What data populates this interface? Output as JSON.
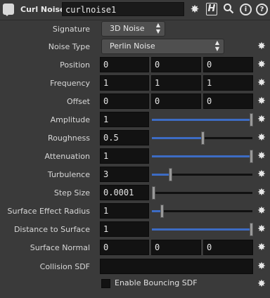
{
  "header": {
    "node_type": "Curl Noise",
    "node_name": "curlnoise1",
    "gear_icon": "gear-icon",
    "h_icon": "H",
    "search_icon": "search-icon",
    "info_icon": "i",
    "help_icon": "?"
  },
  "params": {
    "signature": {
      "label": "Signature",
      "value": "3D Noise"
    },
    "noise_type": {
      "label": "Noise Type",
      "value": "Perlin Noise"
    },
    "position": {
      "label": "Position",
      "v0": "0",
      "v1": "0",
      "v2": "0"
    },
    "frequency": {
      "label": "Frequency",
      "v0": "1",
      "v1": "1",
      "v2": "1"
    },
    "offset": {
      "label": "Offset",
      "v0": "0",
      "v1": "0",
      "v2": "0"
    },
    "amplitude": {
      "label": "Amplitude",
      "value": "1",
      "slider_fraction": 1.0
    },
    "roughness": {
      "label": "Roughness",
      "value": "0.5",
      "slider_fraction": 0.5
    },
    "attenuation": {
      "label": "Attenuation",
      "value": "1",
      "slider_fraction": 1.0
    },
    "turbulence": {
      "label": "Turbulence",
      "value": "3",
      "slider_fraction": 0.18
    },
    "step_size": {
      "label": "Step Size",
      "value": "0.0001",
      "slider_fraction": 0.0
    },
    "surface_effect_radius": {
      "label": "Surface Effect Radius",
      "value": "1",
      "slider_fraction": 0.1
    },
    "distance_to_surface": {
      "label": "Distance to Surface",
      "value": "1",
      "slider_fraction": 1.0
    },
    "surface_normal": {
      "label": "Surface Normal",
      "v0": "0",
      "v1": "0",
      "v2": "0"
    },
    "collision_sdf": {
      "label": "Collision SDF",
      "value": ""
    },
    "enable_bouncing_sdf": {
      "label": "Enable Bouncing SDF",
      "checked": false
    }
  },
  "colors": {
    "background": "#3a3a3a",
    "field": "#121212",
    "slider_fill": "#3d6cc4"
  }
}
